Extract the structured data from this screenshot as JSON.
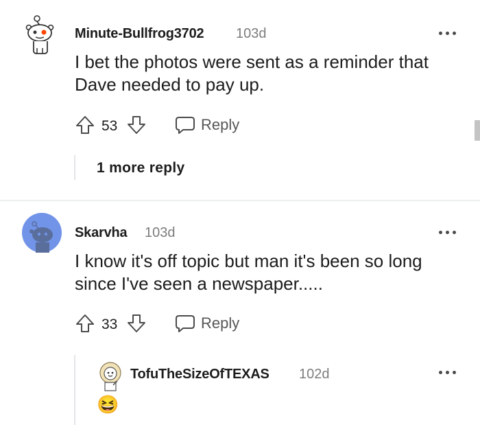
{
  "comments": [
    {
      "username": "Minute-Bullfrog3702",
      "age": "103d",
      "body_lines": [
        "I bet the photos were sent as a reminder that",
        "Dave needed to pay up."
      ],
      "score": "53",
      "reply_label": "Reply",
      "more_replies": "1 more reply",
      "avatar": "snoo-white-avatar-icon"
    },
    {
      "username": "Skarvha",
      "age": "103d",
      "body_lines": [
        "I know it's off topic but man it's been so long",
        "since I've seen a newspaper....."
      ],
      "score": "33",
      "reply_label": "Reply",
      "avatar": "snoo-blue-avatar-icon"
    }
  ],
  "reply": {
    "username": "TofuTheSizeOfTEXAS",
    "age": "102d",
    "body": "😆",
    "avatar": "snoo-lion-avatar-icon"
  },
  "colors": {
    "avatar_blue": "#7193e8",
    "snoo_eye": "#ff4500",
    "emoji_yellow": "#fcd34a"
  }
}
